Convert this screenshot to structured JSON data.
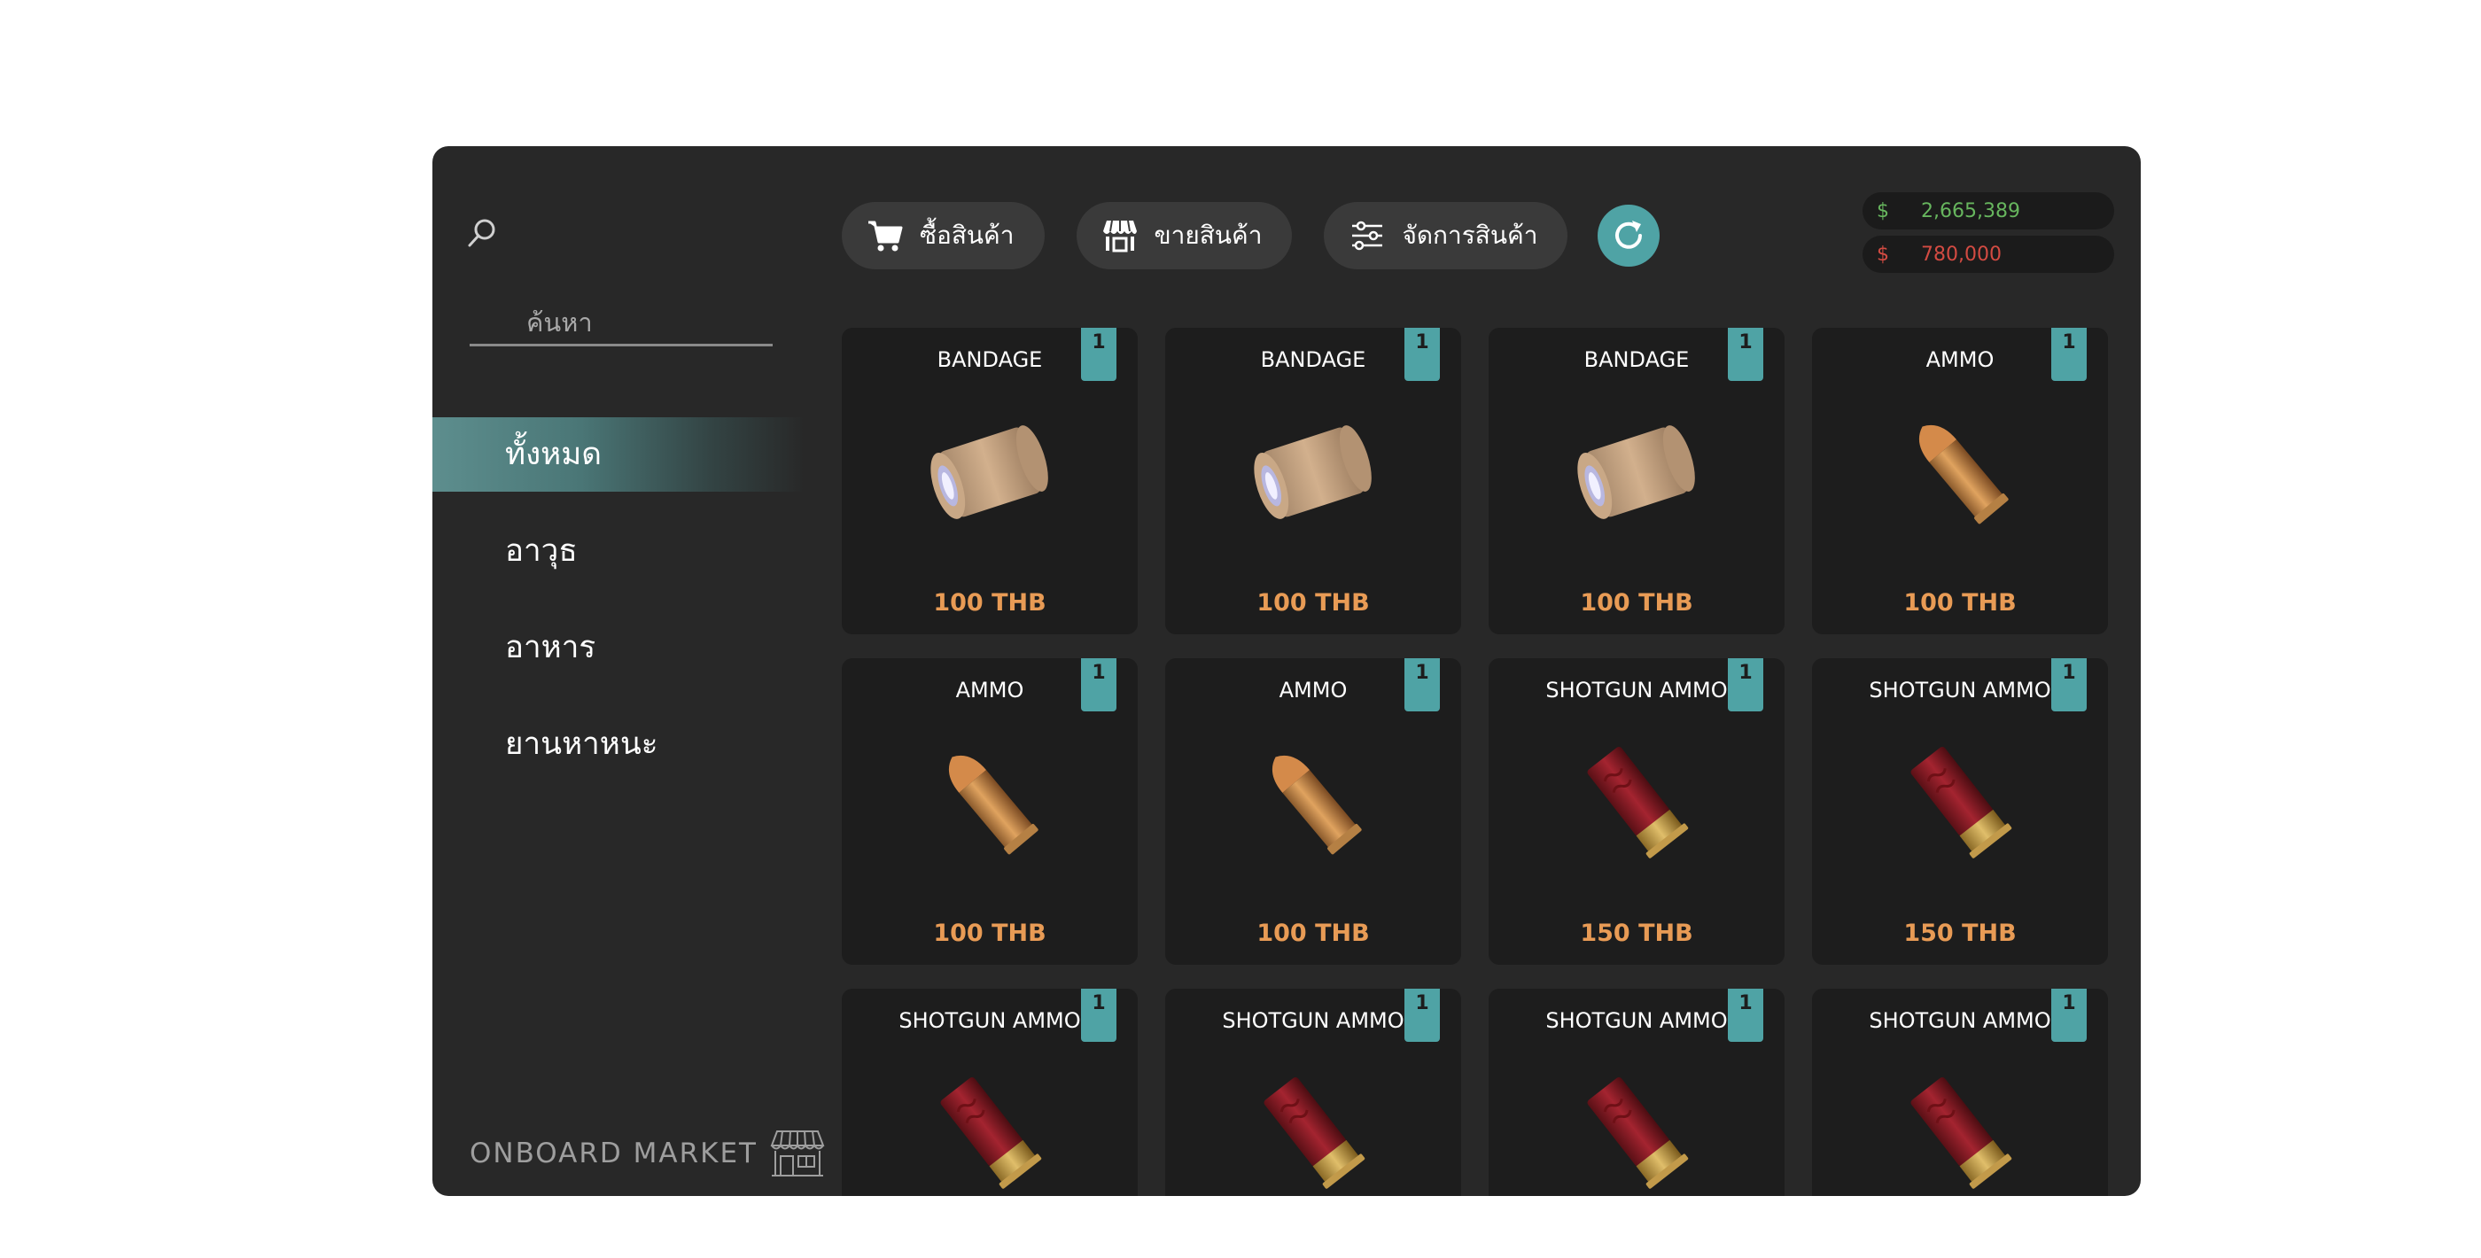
{
  "sidebar": {
    "search_placeholder": "ค้นหา",
    "categories": [
      {
        "label": "ทั้งหมด",
        "active": true
      },
      {
        "label": "อาวุธ",
        "active": false
      },
      {
        "label": "อาหาร",
        "active": false
      },
      {
        "label": "ยานหาหนะ",
        "active": false
      }
    ],
    "brand": "ONBOARD MARKET",
    "brand_icon": "storefront-icon"
  },
  "toolbar": {
    "buy_label": "ซื้อสินค้า",
    "buy_icon": "cart-icon",
    "sell_label": "ขายสินค้า",
    "sell_icon": "shop-icon",
    "manage_label": "จัดการสินค้า",
    "manage_icon": "sliders-icon",
    "refresh_icon": "refresh-icon"
  },
  "money": {
    "cash_symbol": "$",
    "cash": "2,665,389",
    "debt_symbol": "$",
    "debt": "780,000"
  },
  "products": [
    {
      "name": "BANDAGE",
      "qty": "1",
      "price": "100 THB",
      "icon": "bandage-icon"
    },
    {
      "name": "BANDAGE",
      "qty": "1",
      "price": "100 THB",
      "icon": "bandage-icon"
    },
    {
      "name": "BANDAGE",
      "qty": "1",
      "price": "100 THB",
      "icon": "bandage-icon"
    },
    {
      "name": "AMMO",
      "qty": "1",
      "price": "100 THB",
      "icon": "bullet-icon"
    },
    {
      "name": "AMMO",
      "qty": "1",
      "price": "100 THB",
      "icon": "bullet-icon"
    },
    {
      "name": "AMMO",
      "qty": "1",
      "price": "100 THB",
      "icon": "bullet-icon"
    },
    {
      "name": "SHOTGUN AMMO",
      "qty": "1",
      "price": "150 THB",
      "icon": "shotgun-shell-icon"
    },
    {
      "name": "SHOTGUN AMMO",
      "qty": "1",
      "price": "150 THB",
      "icon": "shotgun-shell-icon"
    },
    {
      "name": "SHOTGUN AMMO",
      "qty": "1",
      "price": "",
      "icon": "shotgun-shell-icon"
    },
    {
      "name": "SHOTGUN AMMO",
      "qty": "1",
      "price": "",
      "icon": "shotgun-shell-icon"
    },
    {
      "name": "SHOTGUN AMMO",
      "qty": "1",
      "price": "",
      "icon": "shotgun-shell-icon"
    },
    {
      "name": "SHOTGUN AMMO",
      "qty": "1",
      "price": "",
      "icon": "shotgun-shell-icon"
    }
  ],
  "colors": {
    "accent": "#4fa3a5",
    "price": "#e89b55",
    "cash": "#67b65e",
    "debt": "#d34b42",
    "panel": "#282828",
    "card": "#1d1d1d"
  }
}
